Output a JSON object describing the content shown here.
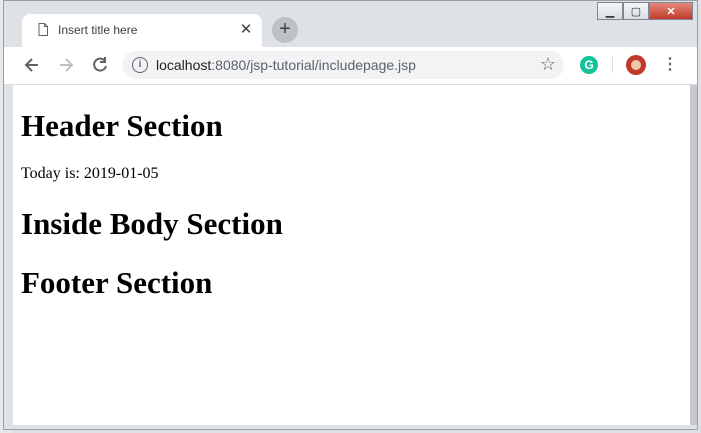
{
  "browser": {
    "tab": {
      "title": "Insert title here",
      "close_glyph": "✕"
    },
    "new_tab_glyph": "+",
    "window_controls": {
      "minimize": "▁",
      "maximize": "▢",
      "close": "✕"
    },
    "url": {
      "host": "localhost",
      "rest": ":8080/jsp-tutorial/includepage.jsp"
    },
    "icons": [
      "document-icon",
      "close-icon",
      "new-tab-icon",
      "back-icon",
      "forward-icon",
      "reload-icon",
      "info-icon",
      "bookmark-star-icon",
      "grammarly-icon",
      "avatar",
      "menu-icon"
    ],
    "grammarly_glyph": "G",
    "accent_colors": {
      "grammarly": "#15c39a",
      "avatar": "#c0392b",
      "close_button": "#c0392b"
    }
  },
  "page": {
    "header_title": "Header Section",
    "date_text": "Today is: 2019-01-05",
    "body_title": "Inside Body Section",
    "footer_title": "Footer Section"
  }
}
